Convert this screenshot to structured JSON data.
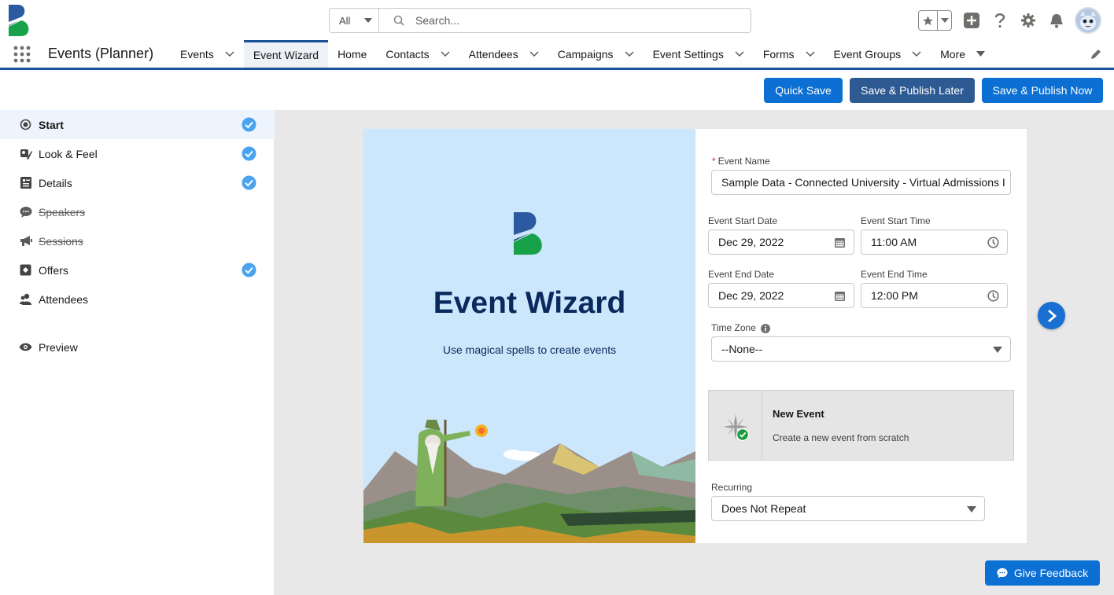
{
  "search": {
    "scope": "All",
    "placeholder": "Search..."
  },
  "nav": {
    "app_name": "Events (Planner)",
    "tabs": [
      {
        "label": "Events",
        "has_menu": true
      },
      {
        "label": "Event Wizard",
        "has_menu": false,
        "active": true
      },
      {
        "label": "Home",
        "has_menu": false
      },
      {
        "label": "Contacts",
        "has_menu": true
      },
      {
        "label": "Attendees",
        "has_menu": true
      },
      {
        "label": "Campaigns",
        "has_menu": true
      },
      {
        "label": "Event Settings",
        "has_menu": true
      },
      {
        "label": "Forms",
        "has_menu": true
      },
      {
        "label": "Event Groups",
        "has_menu": true
      },
      {
        "label": "More",
        "has_menu": true
      }
    ]
  },
  "actions": {
    "quick_save": "Quick Save",
    "publish_later": "Save & Publish Later",
    "publish_now": "Save & Publish Now"
  },
  "sidebar": {
    "steps": [
      {
        "label": "Start",
        "icon": "target-icon",
        "completed": true,
        "active": true
      },
      {
        "label": "Look & Feel",
        "icon": "brush-icon",
        "completed": true
      },
      {
        "label": "Details",
        "icon": "details-icon",
        "completed": true
      },
      {
        "label": "Speakers",
        "icon": "chat-icon",
        "disabled": true
      },
      {
        "label": "Sessions",
        "icon": "megaphone-icon",
        "disabled": true
      },
      {
        "label": "Offers",
        "icon": "offer-icon",
        "completed": true
      },
      {
        "label": "Attendees",
        "icon": "people-icon"
      }
    ],
    "preview": "Preview"
  },
  "hero": {
    "title": "Event Wizard",
    "subtitle": "Use magical spells to create events"
  },
  "form": {
    "event_name_label": "Event Name",
    "event_name_value": "Sample Data - Connected University - Virtual Admissions I",
    "start_date_label": "Event Start Date",
    "start_date_value": "Dec 29, 2022",
    "start_time_label": "Event Start Time",
    "start_time_value": "11:00 AM",
    "end_date_label": "Event End Date",
    "end_date_value": "Dec 29, 2022",
    "end_time_label": "Event End Time",
    "end_time_value": "12:00 PM",
    "timezone_label": "Time Zone",
    "timezone_value": "--None--",
    "new_event_title": "New Event",
    "new_event_desc": "Create a new event from scratch",
    "recurring_label": "Recurring",
    "recurring_value": "Does Not Repeat"
  },
  "feedback": "Give Feedback",
  "colors": {
    "brand": "#0b6fd3",
    "nav_underline": "#1b5297",
    "check": "#4aa3f0"
  }
}
